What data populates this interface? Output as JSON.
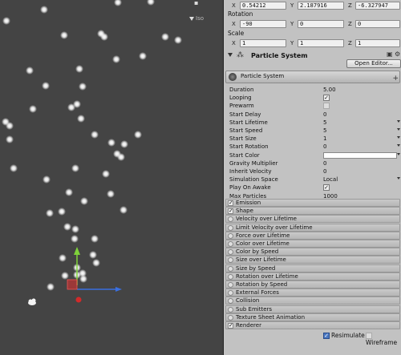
{
  "scene": {
    "iso_label": "Iso"
  },
  "inspector": {
    "position": {
      "x": "0.54212",
      "y": "2.187916",
      "z": "-6.327947"
    },
    "rotation_label": "Rotation",
    "rotation": {
      "x": "-90",
      "y": "0",
      "z": "0"
    },
    "scale_label": "Scale",
    "scale": {
      "x": "1",
      "y": "1",
      "z": "1"
    },
    "axis": {
      "x": "X",
      "y": "Y",
      "z": "Z"
    },
    "component_title": "Particle System",
    "open_editor_label": "Open Editor...",
    "module_header_label": "Particle System",
    "properties": [
      {
        "label": "Duration",
        "value": "5.00",
        "kind": "text"
      },
      {
        "label": "Looping",
        "value": "",
        "kind": "check",
        "checked": true
      },
      {
        "label": "Prewarm",
        "value": "",
        "kind": "check",
        "checked": false
      },
      {
        "label": "Start Delay",
        "value": "0",
        "kind": "text"
      },
      {
        "label": "Start Lifetime",
        "value": "5",
        "kind": "dropdown"
      },
      {
        "label": "Start Speed",
        "value": "5",
        "kind": "dropdown"
      },
      {
        "label": "Start Size",
        "value": "1",
        "kind": "dropdown"
      },
      {
        "label": "Start Rotation",
        "value": "0",
        "kind": "dropdown"
      },
      {
        "label": "Start Color",
        "value": "",
        "kind": "color"
      },
      {
        "label": "Gravity Multiplier",
        "value": "0",
        "kind": "text"
      },
      {
        "label": "Inherit Velocity",
        "value": "0",
        "kind": "text"
      },
      {
        "label": "Simulation Space",
        "value": "Local",
        "kind": "dropdown"
      },
      {
        "label": "Play On Awake",
        "value": "",
        "kind": "check",
        "checked": true
      },
      {
        "label": "Max Particles",
        "value": "1000",
        "kind": "text"
      }
    ],
    "modules": [
      {
        "label": "Emission",
        "checked": true
      },
      {
        "label": "Shape",
        "checked": true
      },
      {
        "label": "Velocity over Lifetime",
        "checked": false
      },
      {
        "label": "Limit Velocity over Lifetime",
        "checked": false
      },
      {
        "label": "Force over Lifetime",
        "checked": false
      },
      {
        "label": "Color over Lifetime",
        "checked": false
      },
      {
        "label": "Color by Speed",
        "checked": false
      },
      {
        "label": "Size over Lifetime",
        "checked": false
      },
      {
        "label": "Size by Speed",
        "checked": false
      },
      {
        "label": "Rotation over Lifetime",
        "checked": false
      },
      {
        "label": "Rotation by Speed",
        "checked": false
      },
      {
        "label": "External Forces",
        "checked": false
      },
      {
        "label": "Collision",
        "checked": false
      },
      {
        "label": "Sub Emitters",
        "checked": false
      },
      {
        "label": "Texture Sheet Animation",
        "checked": false
      },
      {
        "label": "Renderer",
        "checked": true
      }
    ],
    "resimulate_label": "Resimulate",
    "resimulate_checked": true,
    "wireframe_label": "Wireframe",
    "wireframe_checked": false
  },
  "colors": {
    "scene_bg": "#444444",
    "inspector_bg": "#c2c2c2",
    "gizmo_y": "#7fd33a",
    "gizmo_x": "#d22a2a",
    "gizmo_z": "#3a6fe0"
  }
}
